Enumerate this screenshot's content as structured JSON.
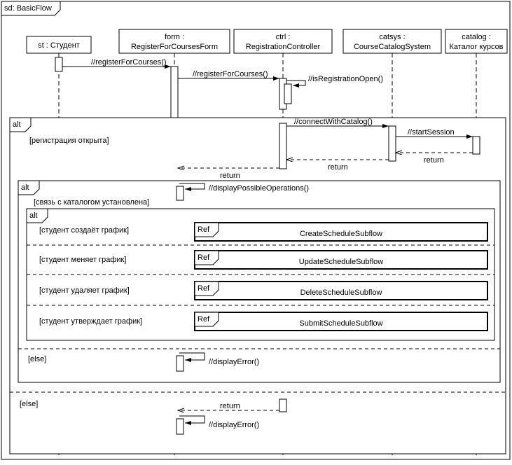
{
  "frame": {
    "title": "sd: BasicFlow"
  },
  "lifelines": {
    "st": {
      "name": "st : Студент"
    },
    "form": {
      "name": "form :",
      "name2": "RegisterForCoursesForm"
    },
    "ctrl": {
      "name": "ctrl :",
      "name2": "RegistrationController"
    },
    "catsys": {
      "name": "catsys :",
      "name2": "CourseCatalogSystem"
    },
    "catalog": {
      "name": "catalog :",
      "name2": "Каталог курсов"
    }
  },
  "messages": {
    "m1": "//registerForCourses()",
    "m2": "//registerForCourses()",
    "m3": "//isRegistrationOpen()",
    "m4": "//connectWithCatalog()",
    "m5": "//startSession",
    "r1": "return",
    "r2": "return",
    "r3": "return",
    "m6": "//displayPossibleOperations()",
    "m7": "//displayError()",
    "r4": "return",
    "m8": "//displayError()"
  },
  "frags": {
    "alt": "alt",
    "ref": "Ref",
    "g1": "[регистрация открыта]",
    "g2": "[связь с каталогом установлена]",
    "g3": "[студент создаёт график]",
    "g4": "[студент меняет график]",
    "g5": "[студент удаляет график]",
    "g6": "[студент утверждает график]",
    "else": "[else]",
    "ref1": "CreateScheduleSubflow",
    "ref2": "UpdateScheduleSubflow",
    "ref3": "DeleteScheduleSubflow",
    "ref4": "SubmitScheduleSubflow"
  }
}
